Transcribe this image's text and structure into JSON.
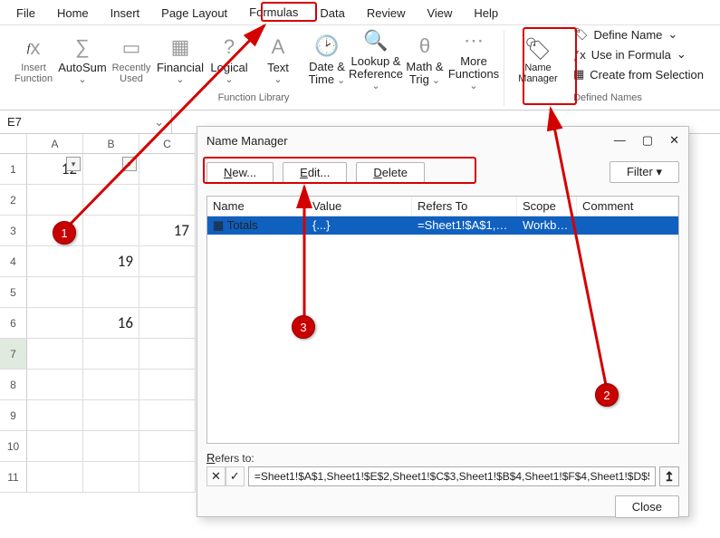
{
  "tabs": [
    "File",
    "Home",
    "Insert",
    "Page Layout",
    "Formulas",
    "Data",
    "Review",
    "View",
    "Help"
  ],
  "active_tab": "Formulas",
  "ribbon": {
    "insert_function": "Insert\nFunction",
    "autosum": "AutoSum",
    "recent": "Recently\nUsed",
    "financial": "Financial",
    "logical": "Logical",
    "text": "Text",
    "datetime": "Date &\nTime",
    "lookup": "Lookup &\nReference",
    "math": "Math &\nTrig",
    "more": "More\nFunctions",
    "group1": "Function Library",
    "name_manager": "Name\nManager",
    "define_name": "Define Name",
    "use_in_formula": "Use in Formula",
    "create_from_sel": "Create from Selection",
    "group2": "Defined Names"
  },
  "namebox": "E7",
  "columns": [
    "A",
    "B",
    "C"
  ],
  "cells": {
    "A1": "12",
    "C3": "17",
    "B4": "19",
    "B6": "16"
  },
  "dialog": {
    "title": "Name Manager",
    "new": "New...",
    "edit": "Edit...",
    "delete": "Delete",
    "filter": "Filter",
    "headers": {
      "name": "Name",
      "value": "Value",
      "refers": "Refers To",
      "scope": "Scope",
      "comment": "Comment"
    },
    "row": {
      "name": "Totals",
      "value": "{...}",
      "refers": "=Sheet1!$A$1,Shee...",
      "scope": "Workbo..."
    },
    "refers_label": "Refers to:",
    "refers_value": "=Sheet1!$A$1,Sheet1!$E$2,Sheet1!$C$3,Sheet1!$B$4,Sheet1!$F$4,Sheet1!$D$5,Sheet1!$B$",
    "close": "Close"
  },
  "callouts": {
    "c1": "1",
    "c2": "2",
    "c3": "3"
  }
}
